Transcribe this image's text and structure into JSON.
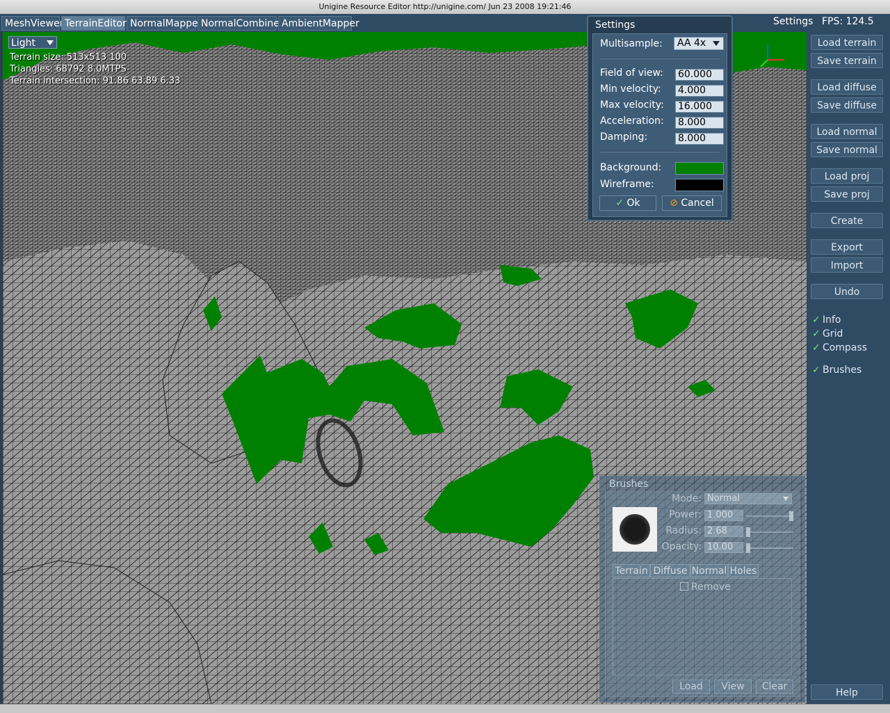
{
  "window": {
    "title": "Unigine Resource Editor http://unigine.com/ Jun 23 2008 19:21:46"
  },
  "tabs": [
    {
      "label": "MeshViewer",
      "active": false
    },
    {
      "label": "TerrainEditor",
      "active": true
    },
    {
      "label": "NormalMapper",
      "active": false
    },
    {
      "label": "NormalCombiner",
      "active": false
    },
    {
      "label": "AmbientMapper",
      "active": false
    }
  ],
  "topbar": {
    "settings_label": "Settings",
    "fps_label": "FPS: 124.5"
  },
  "viewport": {
    "light_select": "Light",
    "info": [
      "Terrain size: 513x513 100",
      "Triangles: 68792 8.0MTPS",
      "Terrain intersection: 91.86 63.89 6.33"
    ],
    "background_color": "#008000",
    "wireframe_color": "#000000"
  },
  "sidebar": {
    "buttons": {
      "load_terrain": "Load terrain",
      "save_terrain": "Save terrain",
      "load_diffuse": "Load diffuse",
      "save_diffuse": "Save diffuse",
      "load_normal": "Load normal",
      "save_normal": "Save normal",
      "load_proj": "Load proj",
      "save_proj": "Save proj",
      "create": "Create",
      "export": "Export",
      "import": "Import",
      "undo": "Undo",
      "help": "Help"
    },
    "checks": {
      "info": {
        "label": "Info",
        "checked": true
      },
      "grid": {
        "label": "Grid",
        "checked": true
      },
      "compass": {
        "label": "Compass",
        "checked": true
      },
      "brushes": {
        "label": "Brushes",
        "checked": true
      }
    }
  },
  "settings": {
    "title": "Settings",
    "multisample": {
      "label": "Multisample:",
      "value": "AA 4x"
    },
    "field_of_view": {
      "label": "Field of view:",
      "value": "60.000"
    },
    "min_velocity": {
      "label": "Min velocity:",
      "value": "4.000"
    },
    "max_velocity": {
      "label": "Max velocity:",
      "value": "16.000"
    },
    "acceleration": {
      "label": "Acceleration:",
      "value": "8.000"
    },
    "damping": {
      "label": "Damping:",
      "value": "8.000"
    },
    "background": {
      "label": "Background:",
      "color": "#008000"
    },
    "wireframe": {
      "label": "Wireframe:",
      "color": "#000000"
    },
    "ok_label": "Ok",
    "cancel_label": "Cancel"
  },
  "brushes": {
    "title": "Brushes",
    "mode": {
      "label": "Mode:",
      "value": "Normal"
    },
    "power": {
      "label": "Power:",
      "value": "1.000",
      "level": 1.0
    },
    "radius": {
      "label": "Radius:",
      "value": "2.68",
      "level": 0.0
    },
    "opacity": {
      "label": "Opacity:",
      "value": "10.00",
      "level": 0.0
    },
    "tabs": [
      "Terrain",
      "Diffuse",
      "Normal",
      "Holes"
    ],
    "remove_label": "Remove",
    "load_label": "Load",
    "view_label": "View",
    "clear_label": "Clear"
  }
}
